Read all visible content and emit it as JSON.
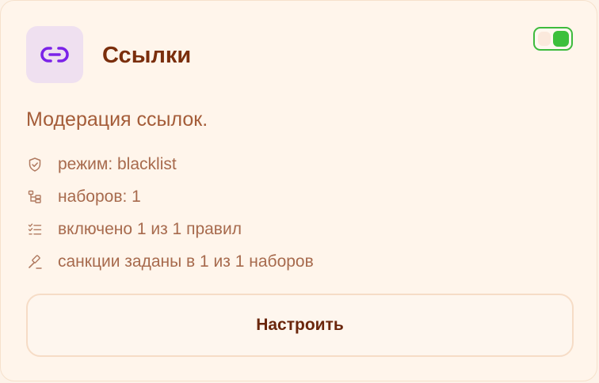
{
  "card": {
    "title": "Ссылки",
    "icon": "link-icon",
    "enabled": true,
    "description": "Модерация ссылок.",
    "details": [
      {
        "icon": "shield-check-icon",
        "text": "режим: blacklist"
      },
      {
        "icon": "tree-structure-icon",
        "text": "наборов: 1"
      },
      {
        "icon": "checklist-icon",
        "text": "включено 1 из 1 правил"
      },
      {
        "icon": "gavel-icon",
        "text": "санкции заданы в 1 из 1 наборов"
      }
    ],
    "configure_label": "Настроить"
  },
  "colors": {
    "accent": "#7a2e0c",
    "text_muted": "#a76a4d",
    "toggle_on": "#3cc03c",
    "icon_purple": "#7b22e8",
    "icon_tile_bg": "#efe0f0"
  }
}
